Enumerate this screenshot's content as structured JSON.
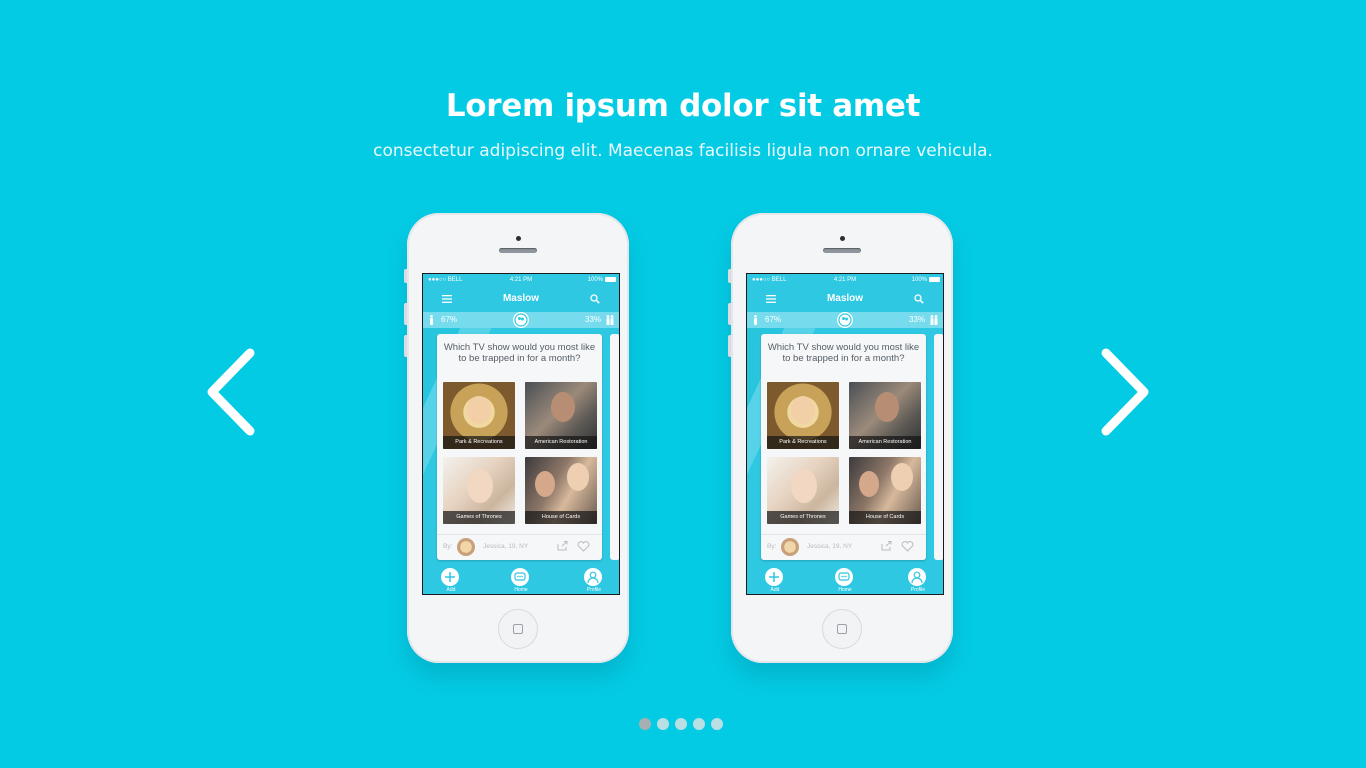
{
  "hero": {
    "title": "Lorem ipsum dolor sit amet",
    "subtitle": "consectetur adipiscing elit. Maecenas facilisis ligula non ornare vehicula."
  },
  "nav": {
    "prev_icon": "chevron-left-icon",
    "next_icon": "chevron-right-icon"
  },
  "colors": {
    "background": "#04cbe4",
    "app_primary": "#2ec8e2",
    "app_stats_bar": "#76dbec"
  },
  "phones": [
    {
      "status": {
        "carrier": "●●●○○ BELL",
        "time": "4:21 PM",
        "battery": "100%"
      },
      "app_title": "Maslow",
      "stats": {
        "left": "67%",
        "right": "33%"
      },
      "question": "Which TV show would you most like to be trapped in for a month?",
      "options": [
        "Park & Recreations",
        "American Restoration",
        "Games of Thrones",
        "House of Cards"
      ],
      "by_label": "By:",
      "author": "Jessica, 19, NY",
      "tabs": [
        "Add",
        "Home",
        "Profile"
      ]
    },
    {
      "status": {
        "carrier": "●●●○○ BELL",
        "time": "4:21 PM",
        "battery": "100%"
      },
      "app_title": "Maslow",
      "stats": {
        "left": "67%",
        "right": "33%"
      },
      "question": "Which TV show would you most like to be trapped in for a month?",
      "options": [
        "Park & Recreations",
        "American Restoration",
        "Games of Thrones",
        "House of Cards"
      ],
      "by_label": "By:",
      "author": "Jessica, 19, NY",
      "tabs": [
        "Add",
        "Home",
        "Profile"
      ]
    }
  ],
  "pagination": {
    "count": 5,
    "active_index": 0
  }
}
